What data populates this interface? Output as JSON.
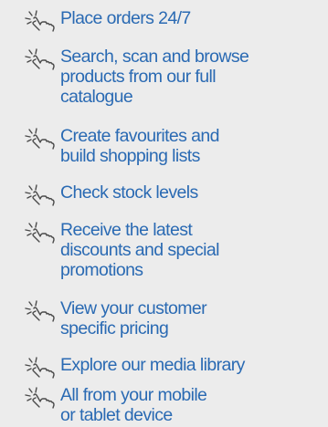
{
  "features": [
    {
      "icon": "hand-click-icon",
      "label": "Place orders 24/7"
    },
    {
      "icon": "hand-click-icon",
      "label": "Search, scan and browse\nproducts from our full\ncatalogue"
    },
    {
      "icon": "hand-click-icon",
      "label": "Create favourites and\nbuild shopping lists"
    },
    {
      "icon": "hand-click-icon",
      "label": "Check stock levels"
    },
    {
      "icon": "hand-click-icon",
      "label": "Receive the latest\ndiscounts and special\npromotions"
    },
    {
      "icon": "hand-click-icon",
      "label": "View your customer\nspecific pricing"
    },
    {
      "icon": "hand-click-icon",
      "label": "Explore our media library"
    },
    {
      "icon": "hand-click-icon",
      "label": "All from your mobile\nor tablet device"
    }
  ],
  "colors": {
    "background": "#ececec",
    "text": "#2a6ab3",
    "icon": "#4a4a4a"
  }
}
